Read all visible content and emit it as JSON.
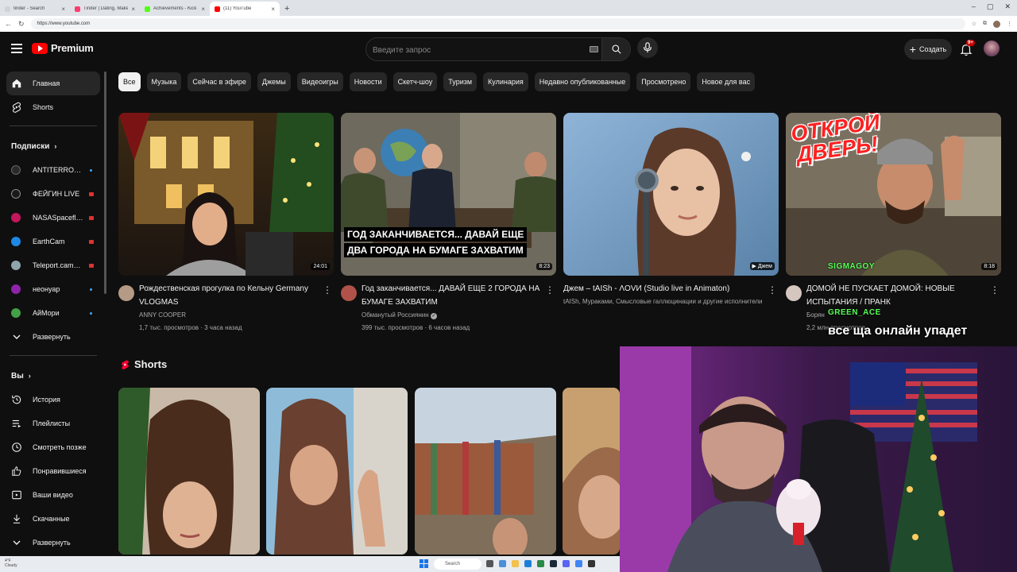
{
  "browser": {
    "tabs": [
      {
        "label": "tinder - Search",
        "color": "#e8eaed"
      },
      {
        "label": "Tinder | Dating, Make Friends & M",
        "color": "#fe3c72"
      },
      {
        "label": "Achievements - Kick Dashboard",
        "color": "#53fc18"
      },
      {
        "label": "(11) YouTube",
        "color": "#ff0000"
      }
    ],
    "url": "https://www.youtube.com"
  },
  "youtube": {
    "logo_text": "Premium",
    "search_placeholder": "Введите запрос",
    "create_label": "Создать",
    "notifications_badge": "9+"
  },
  "sidebar": {
    "main": [
      {
        "label": "Главная",
        "icon": "home-icon"
      },
      {
        "label": "Shorts",
        "icon": "shorts-icon"
      }
    ],
    "subs_header": "Подписки",
    "subscriptions": [
      {
        "label": "ANTITERROR Ch...",
        "avatar_color": "#2a2a2a",
        "status": "new"
      },
      {
        "label": "ФЕЙГИН LIVE",
        "avatar_color": "#1a1a1a",
        "status": "live"
      },
      {
        "label": "NASASpaceflight",
        "avatar_color": "#c2185b",
        "status": "live"
      },
      {
        "label": "EarthCam",
        "avatar_color": "#1e88e5",
        "status": "live"
      },
      {
        "label": "Teleport.camera",
        "avatar_color": "#90a4ae",
        "status": "live"
      },
      {
        "label": "неонуар",
        "avatar_color": "#8e24aa",
        "status": "new"
      },
      {
        "label": "АйМори",
        "avatar_color": "#43a047",
        "status": "new"
      }
    ],
    "expand_label": "Развернуть",
    "you_header": "Вы",
    "you_items": [
      {
        "label": "История",
        "icon": "history-icon"
      },
      {
        "label": "Плейлисты",
        "icon": "playlists-icon"
      },
      {
        "label": "Смотреть позже",
        "icon": "watch-later-icon"
      },
      {
        "label": "Понравившиеся",
        "icon": "like-icon"
      },
      {
        "label": "Ваши видео",
        "icon": "your-videos-icon"
      },
      {
        "label": "Скачанные",
        "icon": "download-icon"
      },
      {
        "label": "Развернуть",
        "icon": "chevron-down-icon"
      }
    ]
  },
  "chips": [
    "Все",
    "Музыка",
    "Сейчас в эфире",
    "Джемы",
    "Видеоигры",
    "Новости",
    "Скетч-шоу",
    "Туризм",
    "Кулинария",
    "Недавно опубликованные",
    "Просмотрено",
    "Новое для вас"
  ],
  "videos": [
    {
      "title": "Рождественская прогулка по Кельну Germany VLOGMAS",
      "channel": "ANNY COOPER",
      "stats": "1,7 тыс. просмотров · 3 часа назад",
      "duration": "24:01",
      "verified": false
    },
    {
      "title": "Год заканчивается... ДАВАЙ ЕЩЕ 2 ГОРОДА НА БУМАГЕ ЗАХВАТИМ",
      "channel": "Обманутый Россиянин",
      "stats": "399 тыс. просмотров · 6 часов назад",
      "duration": "8:23",
      "verified": true,
      "overlay_line1": "ГОД ЗАКАНЧИВАЕТСЯ... ДАВАЙ ЕЩЕ",
      "overlay_line2": "ДВА ГОРОДА НА БУМАГЕ ЗАХВАТИМ"
    },
    {
      "title": "Джем – tAISh - ΛOVИ (Studio live in Animaton)",
      "channel": "tAISh, Мураками, Смысловые галлюцинации и другие исполнители",
      "stats": "",
      "duration": "▶ Джем",
      "verified": false
    },
    {
      "title": "ДОМОЙ НЕ ПУСКАЕТ ДОМОЙ: НОВЫЕ ИСПЫТАНИЯ / ПРАНК",
      "channel": "Борян",
      "stats": "2,2 млн просмотров",
      "duration": "8:18",
      "verified": false,
      "overlay_line1": "ОТКРОЙ",
      "overlay_line2": "ДВЕРЬ!"
    }
  ],
  "shorts_label": "Shorts",
  "chat": [
    {
      "name": "SIGMAGOY"
    },
    {
      "name": "GREEN_ACE",
      "message": "все ща онлайн упадет"
    }
  ],
  "taskbar": {
    "weather_temp": "4°F",
    "weather_desc": "Cloudy",
    "search_label": "Search"
  }
}
